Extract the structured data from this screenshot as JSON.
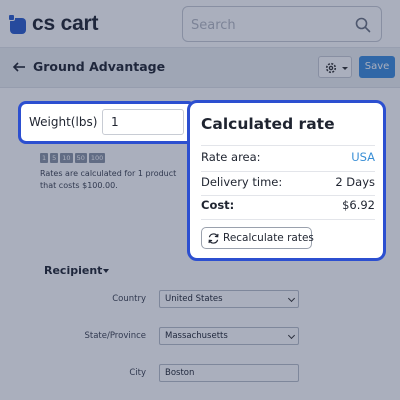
{
  "header": {
    "logo_text": "cs cart",
    "search_placeholder": "Search",
    "brand_color": "#2a5dcc"
  },
  "subheader": {
    "title": "Ground Advantage",
    "save_label": "Save"
  },
  "weight": {
    "label": "Weight(lbs)",
    "value": "1"
  },
  "quantity_chips": [
    "1",
    "5",
    "10",
    "50",
    "100"
  ],
  "rates_note": "Rates are calculated for 1 product that costs $100.00.",
  "rate_panel": {
    "title": "Calculated rate",
    "rows": [
      {
        "key": "Rate area:",
        "value": "USA"
      },
      {
        "key": "Delivery time:",
        "value": "2 Days"
      },
      {
        "key": "Cost:",
        "value": "$6.92"
      }
    ],
    "recalc_label": "Recalculate rates",
    "accent_color": "#2c4fd0",
    "link_color": "#3a8fd6"
  },
  "recipient": {
    "title": "Recipient",
    "fields": [
      {
        "label": "Country",
        "value": "United States"
      },
      {
        "label": "State/Province",
        "value": "Massachusetts"
      },
      {
        "label": "City",
        "value": "Boston"
      }
    ]
  }
}
